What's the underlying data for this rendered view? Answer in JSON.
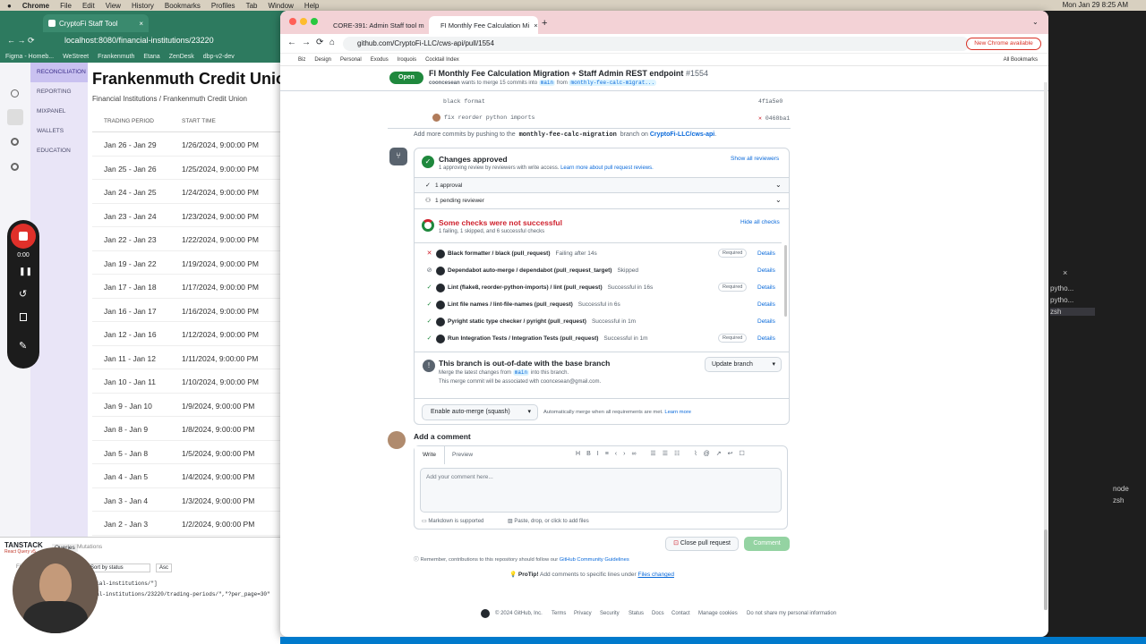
{
  "menubar": {
    "apple": "",
    "items": [
      "Chrome",
      "File",
      "Edit",
      "View",
      "History",
      "Bookmarks",
      "Profiles",
      "Tab",
      "Window",
      "Help"
    ],
    "clock": "Mon Jan 29 8:25 AM"
  },
  "back": {
    "tab_title": "CryptoFi Staff Tool",
    "url": "localhost:8080/financial-institutions/23220",
    "bookmarks": [
      "Figma - Homeb...",
      "WeStreet",
      "Frankenmuth",
      "Etana",
      "ZenDesk",
      "dbp-v2-dev"
    ]
  },
  "app": {
    "nav": [
      "RECONCILIATION",
      "REPORTING",
      "MIXPANEL",
      "WALLETS",
      "EDUCATION"
    ],
    "title": "Frankenmuth Credit Union",
    "breadcrumb": "Financial Institutions  /  Frankenmuth Credit Union",
    "col_period": "TRADING PERIOD",
    "col_start": "START TIME",
    "rows": [
      [
        "Jan 26 - Jan 29",
        "1/26/2024, 9:00:00 PM"
      ],
      [
        "Jan 25 - Jan 26",
        "1/25/2024, 9:00:00 PM"
      ],
      [
        "Jan 24 - Jan 25",
        "1/24/2024, 9:00:00 PM"
      ],
      [
        "Jan 23 - Jan 24",
        "1/23/2024, 9:00:00 PM"
      ],
      [
        "Jan 22 - Jan 23",
        "1/22/2024, 9:00:00 PM"
      ],
      [
        "Jan 19 - Jan 22",
        "1/19/2024, 9:00:00 PM"
      ],
      [
        "Jan 17 - Jan 18",
        "1/17/2024, 9:00:00 PM"
      ],
      [
        "Jan 16 - Jan 17",
        "1/16/2024, 9:00:00 PM"
      ],
      [
        "Jan 12 - Jan 16",
        "1/12/2024, 9:00:00 PM"
      ],
      [
        "Jan 11 - Jan 12",
        "1/11/2024, 9:00:00 PM"
      ],
      [
        "Jan 10 - Jan 11",
        "1/10/2024, 9:00:00 PM"
      ],
      [
        "Jan 9 - Jan 10",
        "1/9/2024, 9:00:00 PM"
      ],
      [
        "Jan 8 - Jan 9",
        "1/8/2024, 9:00:00 PM"
      ],
      [
        "Jan 5 - Jan 8",
        "1/5/2024, 9:00:00 PM"
      ],
      [
        "Jan 4 - Jan 5",
        "1/4/2024, 9:00:00 PM"
      ],
      [
        "Jan 3 - Jan 4",
        "1/3/2024, 9:00:00 PM"
      ],
      [
        "Jan 2 - Jan 3",
        "1/2/2024, 9:00:00 PM"
      ]
    ]
  },
  "rq": {
    "brand": "TANSTACK",
    "sub": "React Query v5",
    "tab_queries": "Queries",
    "tab_mutations": "Mutations",
    "filter": "Filt",
    "sort": "Sort by status",
    "asc": "Asc",
    "q1": "ncial-institutions/\"]",
    "q2": "cial-institutions/23220/trading-periods/\",\"?per_page=30\""
  },
  "rec": {
    "time": "0:00"
  },
  "browser": {
    "tab1": "CORE-391: Admin Staff tool m",
    "tab2": "FI Monthly Fee Calculation Mi",
    "url": "github.com/CryptoFi-LLC/cws-api/pull/1554",
    "new_chrome": "New Chrome available",
    "bookmarks": [
      "Biz",
      "Design",
      "Personal",
      "Exodus",
      "Iroquois",
      "Cocktail Index"
    ],
    "all_bookmarks": "All Bookmarks"
  },
  "pr": {
    "status": "Open",
    "title": "FI Monthly Fee Calculation Migration + Staff Admin REST endpoint",
    "number": "#1554",
    "author": "cooncesean",
    "merge_text": "wants to merge 15 commits into",
    "base": "main",
    "from": "from",
    "head": "monthly-fee-calc-migrat...",
    "commit_prev": "black format",
    "commit_prev_sha": "4f1a5e0",
    "commit_last": "fix reorder python imports",
    "commit_last_sha": "0468ba1",
    "more_pre": "Add more commits by pushing to the",
    "more_branch": "monthly-fee-calc-migration",
    "more_mid": "branch on",
    "more_repo": "CryptoFi-LLC/cws-api",
    "more_end": "."
  },
  "approve": {
    "title": "Changes approved",
    "sub": "1 approving review by reviewers with write access.",
    "learn": "Learn more about pull request reviews.",
    "show_all": "Show all reviewers",
    "approvals": "1 approval",
    "pending": "1 pending reviewer"
  },
  "checks": {
    "title": "Some checks were not successful",
    "sub": "1 failing, 1 skipped, and 6 successful checks",
    "hide": "Hide all checks",
    "required": "Required",
    "details": "Details",
    "items": [
      {
        "status": "✕",
        "name": "Black formatter / black (pull_request)",
        "result": "Failing after 14s",
        "required": true
      },
      {
        "status": "⊘",
        "name": "Dependabot auto-merge / dependabot (pull_request_target)",
        "result": "Skipped",
        "required": false
      },
      {
        "status": "✓",
        "name": "Lint (flake8, reorder-python-imports) / lint (pull_request)",
        "result": "Successful in 16s",
        "required": true
      },
      {
        "status": "✓",
        "name": "Lint file names / lint-file-names (pull_request)",
        "result": "Successful in 6s",
        "required": false
      },
      {
        "status": "✓",
        "name": "Pyright static type checker / pyright (pull_request)",
        "result": "Successful in 1m",
        "required": false
      },
      {
        "status": "✓",
        "name": "Run Integration Tests / Integration Tests (pull_request)",
        "result": "Successful in 1m",
        "required": true
      }
    ]
  },
  "outdated": {
    "title": "This branch is out-of-date with the base branch",
    "sub1": "Merge the latest changes from",
    "base": "main",
    "sub2": "into this branch.",
    "sub3": "This merge commit will be associated with cooncesean@gmail.com.",
    "button": "Update branch"
  },
  "automerge": {
    "button": "Enable auto-merge (squash)",
    "text": "Automatically merge when all requirements are met.",
    "learn": "Learn more"
  },
  "comment": {
    "heading": "Add a comment",
    "write": "Write",
    "preview": "Preview",
    "placeholder": "Add your comment here...",
    "markdown": "Markdown is supported",
    "attach": "Paste, drop, or click to add files",
    "close": "Close pull request",
    "submit": "Comment",
    "reminder_pre": "Remember, contributions to this repository should follow our",
    "reminder_link": "GitHub Community Guidelines",
    "protip_label": "ProTip!",
    "protip": "Add comments to specific lines under",
    "protip_link": "Files changed"
  },
  "footer": {
    "copy": "© 2024 GitHub, Inc.",
    "links": [
      "Terms",
      "Privacy",
      "Security",
      "Status",
      "Docs",
      "Contact",
      "Manage cookies",
      "Do not share my personal information"
    ]
  },
  "term": {
    "items": [
      "pytho...",
      "pytho...",
      "zsh",
      "node",
      "zsh"
    ]
  },
  "colors": {
    "green": "#1f883d",
    "red": "#cf222e",
    "link": "#0969da"
  }
}
